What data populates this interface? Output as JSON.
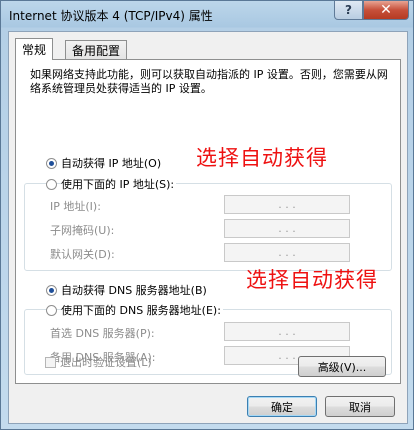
{
  "window": {
    "title": "Internet 协议版本 4 (TCP/IPv4) 属性",
    "help_label": "?",
    "close_label": "✕"
  },
  "tabs": [
    {
      "label": "常规",
      "active": true
    },
    {
      "label": "备用配置",
      "active": false
    }
  ],
  "description": "如果网络支持此功能，则可以获取自动指派的 IP 设置。否则，您需要从网络系统管理员处获得适当的 IP 设置。",
  "ip_section": {
    "auto_label": "自动获得 IP 地址(O)",
    "manual_label": "使用下面的 IP 地址(S):",
    "selected": "auto",
    "fields": [
      {
        "label": "IP 地址(I):",
        "value": ". . ."
      },
      {
        "label": "子网掩码(U):",
        "value": ". . ."
      },
      {
        "label": "默认网关(D):",
        "value": ". . ."
      }
    ]
  },
  "dns_section": {
    "auto_label": "自动获得 DNS 服务器地址(B)",
    "manual_label": "使用下面的 DNS 服务器地址(E):",
    "selected": "auto",
    "fields": [
      {
        "label": "首选 DNS 服务器(P):",
        "value": ". . ."
      },
      {
        "label": "备用 DNS 服务器(A):",
        "value": ". . ."
      }
    ]
  },
  "annotations": {
    "ip_note": "选择自动获得",
    "dns_note": "选择自动获得",
    "color": "#ee1111"
  },
  "validate_label": "退出时验证设置(L)",
  "buttons": {
    "advanced": "高级(V)...",
    "ok": "确定",
    "cancel": "取消"
  }
}
